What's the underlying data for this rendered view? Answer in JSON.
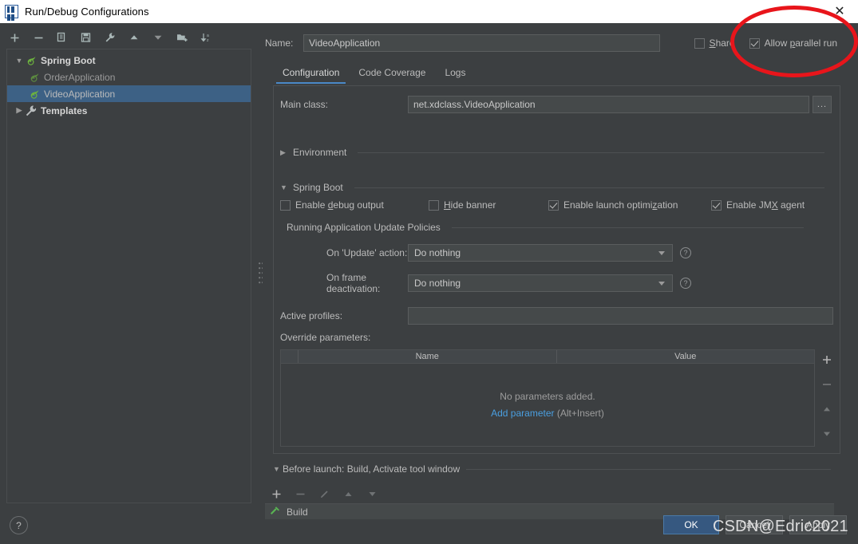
{
  "window": {
    "title": "Run/Debug Configurations",
    "app_icon": "intellij-idea-icon",
    "close_icon": "close-icon"
  },
  "left_panel": {
    "toolbar": [
      {
        "name": "add-configuration-button",
        "icon": "plus-icon",
        "label": "+"
      },
      {
        "name": "remove-configuration-button",
        "icon": "minus-icon",
        "label": "−"
      },
      {
        "name": "copy-configuration-button",
        "icon": "copy-icon",
        "label": ""
      },
      {
        "name": "save-configuration-button",
        "icon": "save-icon",
        "label": ""
      },
      {
        "name": "edit-templates-button",
        "icon": "wrench-icon",
        "label": ""
      },
      {
        "name": "move-up-button",
        "icon": "arrow-up-icon",
        "label": ""
      },
      {
        "name": "move-down-button",
        "icon": "arrow-down-icon",
        "label": ""
      },
      {
        "name": "new-folder-button",
        "icon": "folder-add-icon",
        "label": ""
      },
      {
        "name": "sort-configurations-button",
        "icon": "sort-az-icon",
        "label": ""
      }
    ],
    "tree": [
      {
        "label": "Spring Boot",
        "level": 0,
        "expanded": true,
        "bold": true,
        "icon": "spring-boot-icon",
        "selected": false
      },
      {
        "label": "OrderApplication",
        "level": 1,
        "expanded": null,
        "bold": false,
        "icon": "spring-boot-icon",
        "selected": false
      },
      {
        "label": "VideoApplication",
        "level": 1,
        "expanded": null,
        "bold": false,
        "icon": "spring-boot-icon",
        "selected": true
      },
      {
        "label": "Templates",
        "level": 0,
        "expanded": false,
        "bold": true,
        "icon": "wrench-icon",
        "selected": false
      }
    ]
  },
  "right_panel": {
    "name_label": "Name:",
    "name_value": "VideoApplication",
    "share": {
      "label": "Share",
      "checked": false,
      "mnemonic": "S"
    },
    "allow_parallel_run": {
      "label": "Allow parallel run",
      "checked": true,
      "mnemonic": "p"
    },
    "tabs": [
      {
        "label": "Configuration",
        "active": true
      },
      {
        "label": "Code Coverage",
        "active": false
      },
      {
        "label": "Logs",
        "active": false
      }
    ],
    "main_class": {
      "label": "Main class:",
      "value": "net.xdclass.VideoApplication",
      "browse_label": "..."
    },
    "environment_section": {
      "label": "Environment",
      "expanded": false
    },
    "spring_boot_section": {
      "label": "Spring Boot",
      "expanded": true,
      "checkboxes": [
        {
          "label": "Enable debug output",
          "checked": false,
          "mnemonic": "d"
        },
        {
          "label": "Hide banner",
          "checked": false,
          "mnemonic": "H"
        },
        {
          "label": "Enable launch optimization",
          "checked": true,
          "mnemonic": "z"
        },
        {
          "label": "Enable JMX agent",
          "checked": true,
          "mnemonic": "X"
        }
      ]
    },
    "update_policies": {
      "group_label": "Running Application Update Policies",
      "rows": [
        {
          "label": "On 'Update' action:",
          "value": "Do nothing",
          "help": "?"
        },
        {
          "label": "On frame deactivation:",
          "value": "Do nothing",
          "help": "?"
        }
      ]
    },
    "active_profiles": {
      "label": "Active profiles:",
      "value": "",
      "placeholder": ""
    },
    "override_parameters": {
      "label": "Override parameters:",
      "columns": [
        "",
        "Name",
        "Value"
      ],
      "rows": [],
      "empty_text": "No parameters added.",
      "add_link": "Add parameter",
      "add_hint": "(Alt+Insert)",
      "side_buttons": [
        {
          "name": "add-parameter-button",
          "icon": "plus-icon",
          "label": "+",
          "enabled": true
        },
        {
          "name": "remove-parameter-button",
          "icon": "minus-icon",
          "label": "−",
          "enabled": false
        },
        {
          "name": "parameter-move-up-button",
          "icon": "arrow-up-icon",
          "label": "",
          "enabled": false
        },
        {
          "name": "parameter-move-down-button",
          "icon": "arrow-down-icon",
          "label": "",
          "enabled": false
        }
      ]
    },
    "before_launch": {
      "header": "Before launch: Build, Activate tool window",
      "expanded": true,
      "toolbar": [
        {
          "name": "before-launch-add-button",
          "icon": "plus-icon",
          "label": "+",
          "enabled": true
        },
        {
          "name": "before-launch-remove-button",
          "icon": "minus-icon",
          "label": "−",
          "enabled": false
        },
        {
          "name": "before-launch-edit-button",
          "icon": "pencil-icon",
          "label": "",
          "enabled": false
        },
        {
          "name": "before-launch-move-up-button",
          "icon": "arrow-up-icon",
          "label": "",
          "enabled": false
        },
        {
          "name": "before-launch-move-down-button",
          "icon": "arrow-down-icon",
          "label": "",
          "enabled": false
        }
      ],
      "tasks": [
        {
          "label": "Build",
          "icon": "build-hammer-icon"
        }
      ]
    }
  },
  "footer": {
    "help_label": "?",
    "buttons": [
      {
        "label": "OK",
        "primary": true,
        "name": "ok-button"
      },
      {
        "label": "Cancel",
        "primary": false,
        "name": "cancel-button"
      },
      {
        "label": "Apply",
        "primary": false,
        "name": "apply-button"
      }
    ]
  },
  "overlay": {
    "watermark": "CSDN@Edric2021",
    "annotation_shape": "red-ellipse-highlight",
    "annotation_color": "#e8151b"
  },
  "colors": {
    "background": "#3c3f41",
    "selection": "#3d6185",
    "accent": "#4a88c7",
    "link": "#4a9fe0",
    "primary_button": "#365880",
    "annotation": "#e8151b"
  }
}
